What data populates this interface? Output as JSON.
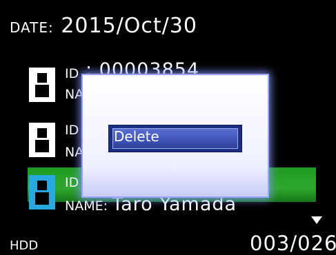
{
  "header": {
    "date_label": "DATE:",
    "date_value": "2015/Oct/30"
  },
  "clips": [
    {
      "id_label": "ID",
      "id_value": ": 00003854",
      "name_label": "NAME:"
    },
    {
      "id_label": "ID",
      "name_label": "NAME:"
    },
    {
      "id_label": "ID",
      "name_label": "NAME:",
      "name_value": "Taro Yamada",
      "selected": true
    }
  ],
  "dialog": {
    "option_label": "Delete"
  },
  "footer": {
    "storage": "HDD",
    "page_counter": "003/026"
  },
  "colors": {
    "selected_row": "#2ea82c",
    "selected_icon": "#27a9e0",
    "dialog_option": "#3e52b6"
  }
}
